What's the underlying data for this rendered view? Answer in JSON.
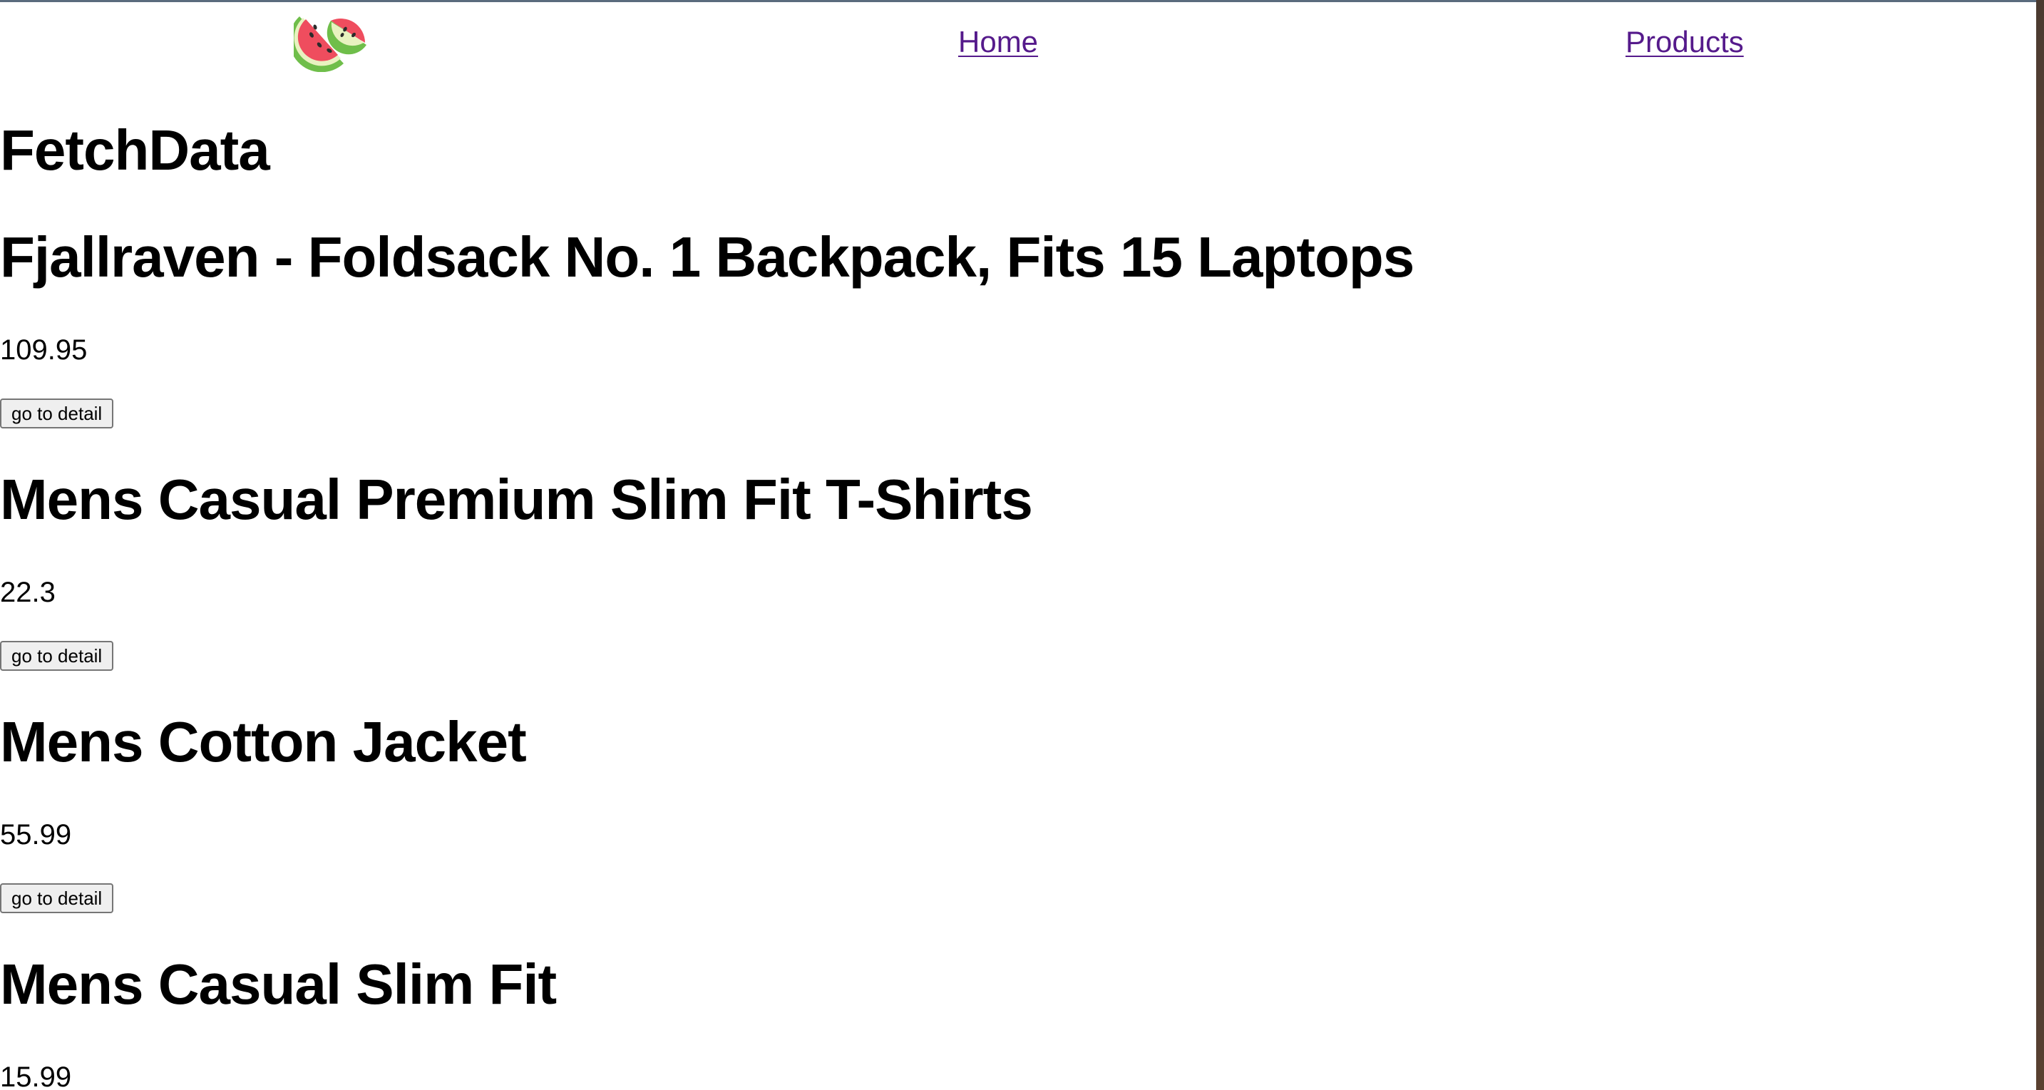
{
  "nav": {
    "logo_icon": "watermelon-icon",
    "links": [
      {
        "label": "Home"
      },
      {
        "label": "Products"
      }
    ],
    "link_color": "#551a8b"
  },
  "page": {
    "title": "FetchData"
  },
  "products": [
    {
      "title": "Fjallraven - Foldsack No. 1 Backpack, Fits 15 Laptops",
      "price": "109.95",
      "button_label": "go to detail"
    },
    {
      "title": "Mens Casual Premium Slim Fit T-Shirts",
      "price": "22.3",
      "button_label": "go to detail"
    },
    {
      "title": "Mens Cotton Jacket",
      "price": "55.99",
      "button_label": "go to detail"
    },
    {
      "title": "Mens Casual Slim Fit",
      "price": "15.99"
    }
  ]
}
